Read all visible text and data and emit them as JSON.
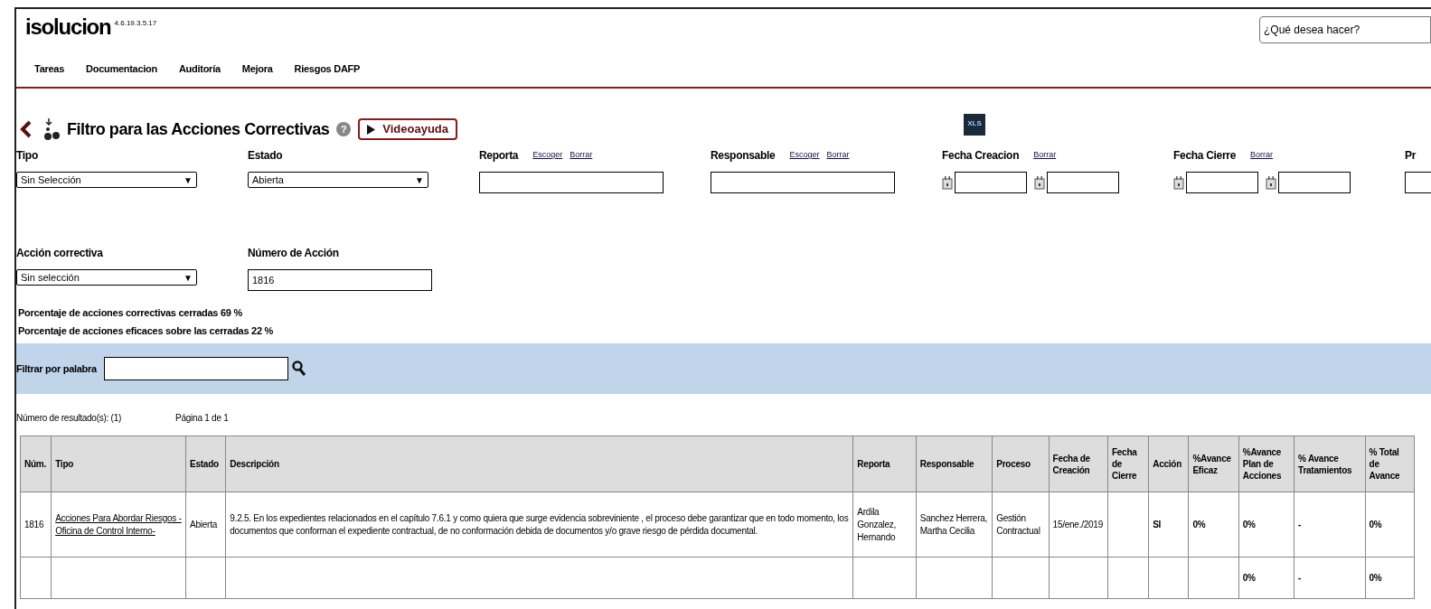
{
  "header": {
    "logo": "isolucion",
    "version": "4.6.19.3.5.17",
    "search": {
      "placeholder": "¿Qué desea hacer?"
    }
  },
  "nav": [
    "Tareas",
    "Documentacion",
    "Auditoría",
    "Mejora",
    "Riesgos DAFP"
  ],
  "title": {
    "text": "Filtro para las Acciones Correctivas",
    "help": "?",
    "video_button": "Videoayuda"
  },
  "export_icon_label": "XLS",
  "filters_row1": [
    {
      "kind": "select",
      "label": "Tipo",
      "value": "Sin Selección",
      "arrow": "▼"
    },
    {
      "kind": "select",
      "label": "Estado",
      "value": "Abierta",
      "arrow": "▼"
    },
    {
      "kind": "picker",
      "label": "Reporta",
      "links": [
        "Escoger",
        "Borrar"
      ]
    },
    {
      "kind": "picker",
      "label": "Responsable",
      "links": [
        "Escoger",
        "Borrar"
      ]
    },
    {
      "kind": "daterange",
      "label": "Fecha Creacion",
      "links": [
        "Borrar"
      ]
    },
    {
      "kind": "daterange",
      "label": "Fecha Cierre",
      "links": [
        "Borrar"
      ]
    },
    {
      "kind": "text",
      "label": "Pr"
    }
  ],
  "filters_row2": [
    {
      "kind": "select",
      "label": "Acción correctiva",
      "value": "Sin selección",
      "arrow": "▼"
    },
    {
      "kind": "text",
      "label": "Número de Acción",
      "value": "1816"
    }
  ],
  "stats": [
    "Porcentaje de acciones correctivas cerradas 69 %",
    "Porcentaje de acciones eficaces sobre las cerradas 22 %"
  ],
  "word_filter": {
    "label": "Filtrar por palabra"
  },
  "results": {
    "count": "Número de resultado(s): (1)",
    "page": "Página 1 de 1"
  },
  "table": {
    "columns": [
      "Núm.",
      "Tipo",
      "Estado",
      "Descripción",
      "Reporta",
      "Responsable",
      "Proceso",
      "Fecha de Creación",
      "Fecha de Cierre",
      "Acción",
      "%Avance Eficaz",
      "%Avance Plan de Acciones",
      "% Avance Tratamientos",
      "% Total de Avance"
    ],
    "rows": [
      [
        "1816",
        "Acciones Para Abordar Riesgos -Oficina de Control Interno-",
        "Abierta",
        "9.2.5. En los expedientes relacionados en el capítulo 7.6.1 y como quiera que surge evidencia sobreviniente , el proceso debe garantizar que en todo momento, los documentos que conforman el expediente contractual, de no conformación debida de documentos y/o grave riesgo de pérdida documental.",
        "Ardila Gonzalez, Hernando",
        "Sanchez Herrera, Martha Cecilia",
        "Gestión Contractual",
        "15/ene./2019",
        "",
        "SI",
        "0%",
        "0%",
        "-",
        "0%"
      ],
      [
        "",
        "",
        "",
        "",
        "",
        "",
        "",
        "",
        "",
        "",
        "",
        "0%",
        "-",
        "0%"
      ]
    ]
  }
}
